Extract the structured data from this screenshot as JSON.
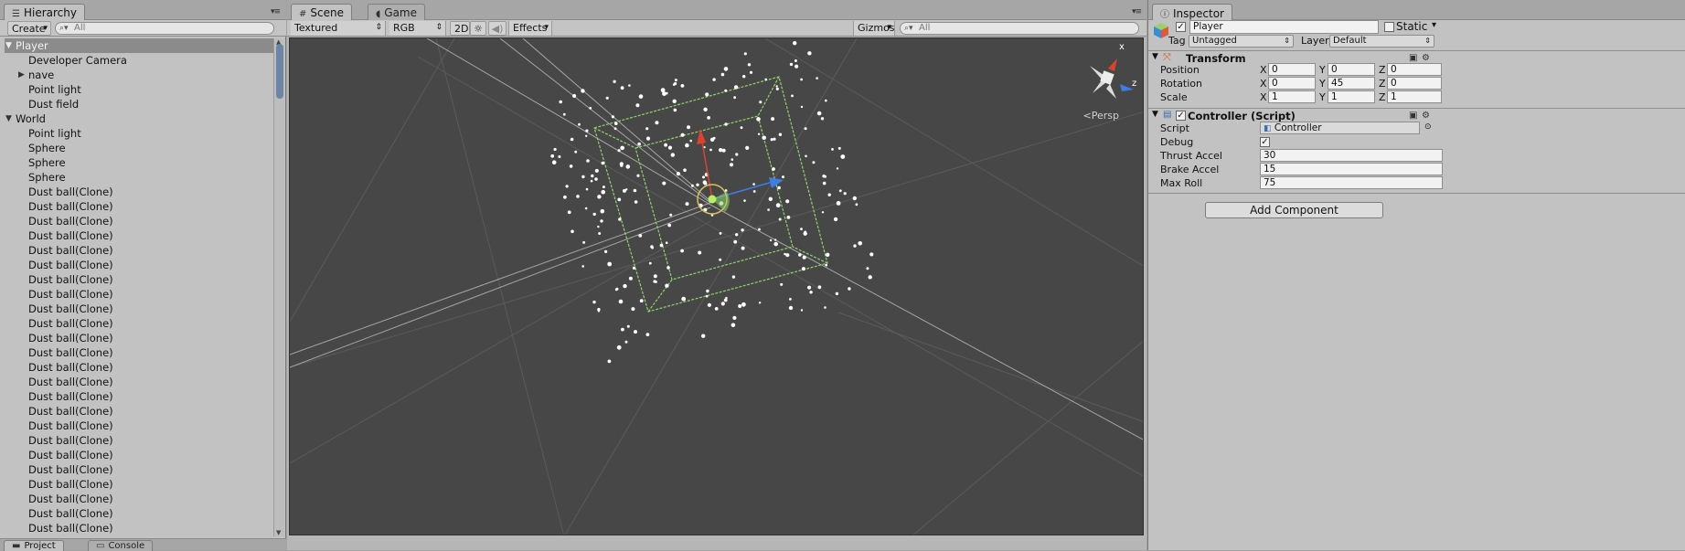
{
  "hierarchy": {
    "tab_label": "Hierarchy",
    "create_label": "Create",
    "search_placeholder": "All",
    "items": [
      {
        "label": "Player",
        "depth": 0,
        "expanded": true,
        "selected": true
      },
      {
        "label": "Developer Camera",
        "depth": 1
      },
      {
        "label": "nave",
        "depth": 1,
        "collapsed": true
      },
      {
        "label": "Point light",
        "depth": 1
      },
      {
        "label": "Dust field",
        "depth": 1
      },
      {
        "label": "World",
        "depth": 0,
        "expanded": true
      },
      {
        "label": "Point light",
        "depth": 1
      },
      {
        "label": "Sphere",
        "depth": 1
      },
      {
        "label": "Sphere",
        "depth": 1
      },
      {
        "label": "Sphere",
        "depth": 1
      },
      {
        "label": "Dust ball(Clone)",
        "depth": 1
      },
      {
        "label": "Dust ball(Clone)",
        "depth": 1
      },
      {
        "label": "Dust ball(Clone)",
        "depth": 1
      },
      {
        "label": "Dust ball(Clone)",
        "depth": 1
      },
      {
        "label": "Dust ball(Clone)",
        "depth": 1
      },
      {
        "label": "Dust ball(Clone)",
        "depth": 1
      },
      {
        "label": "Dust ball(Clone)",
        "depth": 1
      },
      {
        "label": "Dust ball(Clone)",
        "depth": 1
      },
      {
        "label": "Dust ball(Clone)",
        "depth": 1
      },
      {
        "label": "Dust ball(Clone)",
        "depth": 1
      },
      {
        "label": "Dust ball(Clone)",
        "depth": 1
      },
      {
        "label": "Dust ball(Clone)",
        "depth": 1
      },
      {
        "label": "Dust ball(Clone)",
        "depth": 1
      },
      {
        "label": "Dust ball(Clone)",
        "depth": 1
      },
      {
        "label": "Dust ball(Clone)",
        "depth": 1
      },
      {
        "label": "Dust ball(Clone)",
        "depth": 1
      },
      {
        "label": "Dust ball(Clone)",
        "depth": 1
      },
      {
        "label": "Dust ball(Clone)",
        "depth": 1
      },
      {
        "label": "Dust ball(Clone)",
        "depth": 1
      },
      {
        "label": "Dust ball(Clone)",
        "depth": 1
      },
      {
        "label": "Dust ball(Clone)",
        "depth": 1
      },
      {
        "label": "Dust ball(Clone)",
        "depth": 1
      },
      {
        "label": "Dust ball(Clone)",
        "depth": 1
      },
      {
        "label": "Dust ball(Clone)",
        "depth": 1
      }
    ],
    "bottom_tabs": [
      "Project",
      "Console"
    ]
  },
  "scene": {
    "tabs": [
      {
        "label": "Scene",
        "active": true,
        "icon": "grid-icon"
      },
      {
        "label": "Game",
        "active": false,
        "icon": "pacman-icon"
      }
    ],
    "toolbar": {
      "draw_mode": "Textured",
      "render_mode": "RGB",
      "toggle_2d": "2D",
      "effects": "Effects",
      "gizmos": "Gizmos",
      "search_placeholder": "All"
    },
    "persp_label": "Persp",
    "gizmo_axes": {
      "x": "x",
      "z": "z"
    }
  },
  "inspector": {
    "tab_label": "Inspector",
    "object_name": "Player",
    "static_label": "Static",
    "tag_label": "Tag",
    "tag_value": "Untagged",
    "layer_label": "Layer",
    "layer_value": "Default",
    "transform": {
      "title": "Transform",
      "position_label": "Position",
      "rotation_label": "Rotation",
      "scale_label": "Scale",
      "axis_x": "X",
      "axis_y": "Y",
      "axis_z": "Z",
      "position": {
        "x": "0",
        "y": "0",
        "z": "0"
      },
      "rotation": {
        "x": "0",
        "y": "45",
        "z": "0"
      },
      "scale": {
        "x": "1",
        "y": "1",
        "z": "1"
      }
    },
    "controller": {
      "title": "Controller (Script)",
      "script_label": "Script",
      "script_value": "Controller",
      "debug_label": "Debug",
      "debug_checked": true,
      "thrust_label": "Thrust Accel",
      "thrust_value": "30",
      "brake_label": "Brake Accel",
      "brake_value": "15",
      "maxroll_label": "Max Roll",
      "maxroll_value": "75"
    },
    "add_component_label": "Add Component"
  },
  "colors": {
    "viewport_bg": "#474747",
    "bounds_green": "#8fd46a",
    "axis_red": "#e0412c",
    "axis_blue": "#3f7de6",
    "selection": "#8b8b8b"
  }
}
